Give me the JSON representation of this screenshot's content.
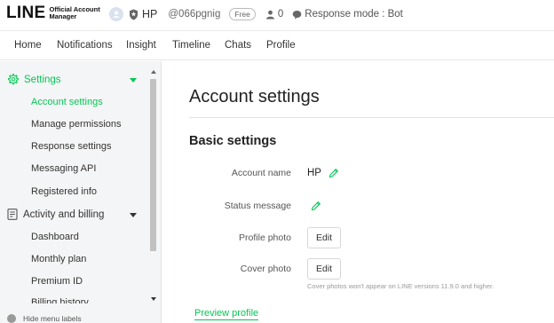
{
  "header": {
    "logo_main": "LINE",
    "logo_sub_line1": "Official Account",
    "logo_sub_line2": "Manager",
    "account_name": "HP",
    "account_id": "@066pgnig",
    "plan_badge": "Free",
    "friends_count": "0",
    "response_mode": "Response mode : Bot",
    "icons": [
      "avatar-icon",
      "shield-icon",
      "person-icon",
      "chat-bubble-icon"
    ]
  },
  "nav": {
    "items": [
      "Home",
      "Notifications",
      "Insight",
      "Timeline",
      "Chats",
      "Profile"
    ]
  },
  "sidebar": {
    "settings_label": "Settings",
    "settings_items": [
      "Account settings",
      "Manage permissions",
      "Response settings",
      "Messaging API",
      "Registered info"
    ],
    "activity_label": "Activity and billing",
    "activity_items": [
      "Dashboard",
      "Monthly plan",
      "Premium ID",
      "Billing history"
    ],
    "hide_menu_label": "Hide menu labels"
  },
  "main": {
    "page_title": "Account settings",
    "section_title": "Basic settings",
    "rows": {
      "account_name_label": "Account name",
      "account_name_value": "HP",
      "status_message_label": "Status message",
      "profile_photo_label": "Profile photo",
      "profile_photo_button": "Edit",
      "cover_photo_label": "Cover photo",
      "cover_photo_button": "Edit"
    },
    "cover_note": "Cover photos won't appear on LINE versions 11.9.0 and higher.",
    "preview_link": "Preview profile"
  },
  "colors": {
    "accent": "#06c755",
    "sidebar_bg": "#f4f5f6",
    "text": "#333333"
  }
}
